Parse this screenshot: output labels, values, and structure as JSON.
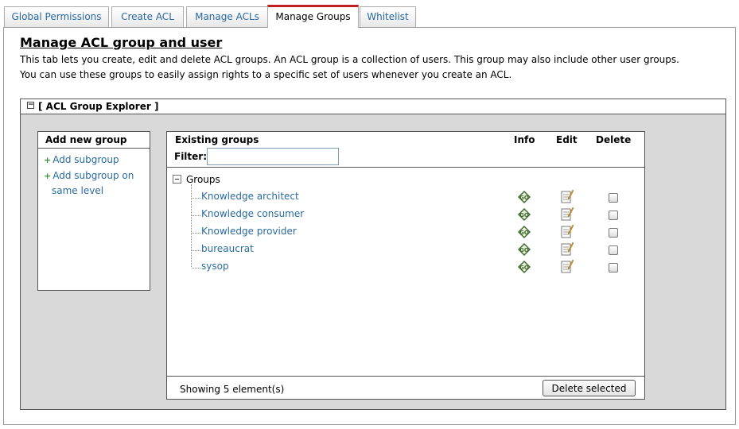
{
  "tabs": [
    {
      "label": "Global Permissions"
    },
    {
      "label": "Create ACL"
    },
    {
      "label": "Manage ACLs"
    },
    {
      "label": "Manage Groups"
    },
    {
      "label": "Whitelist"
    }
  ],
  "active_tab": "Manage Groups",
  "page": {
    "title": "Manage ACL group and user",
    "description_line1": "This tab lets you create, edit and delete ACL groups. An ACL group is a collection of users. This group may also include other user groups.",
    "description_line2": "You can use these groups to easily assign rights to a specific set of users whenever you create an ACL."
  },
  "explorer": {
    "title": "[ ACL Group Explorer ]",
    "add_box": {
      "heading": "Add new group",
      "add_subgroup": "Add subgroup",
      "add_same_level_line1": "Add subgroup on",
      "add_same_level_line2": "same level"
    },
    "groups_panel": {
      "heading": "Existing groups",
      "col_info": "Info",
      "col_edit": "Edit",
      "col_delete": "Delete",
      "filter_label": "Filter:",
      "filter_value": "",
      "root_label": "Groups",
      "items": [
        {
          "name": "Knowledge architect"
        },
        {
          "name": "Knowledge consumer"
        },
        {
          "name": "Knowledge provider"
        },
        {
          "name": "bureaucrat"
        },
        {
          "name": "sysop"
        }
      ],
      "status": "Showing 5 element(s)",
      "delete_button": "Delete selected"
    }
  },
  "icons": {
    "info": "info-diamond-icon",
    "edit": "notepad-pencil-icon",
    "collapse": "minus-box-icon",
    "add": "plus-icon"
  },
  "colors": {
    "link": "#2a6aa0",
    "active_tab_accent": "#c02020",
    "explorer_bg": "#d9d9d9",
    "info_icon": "#3d6b2e"
  }
}
